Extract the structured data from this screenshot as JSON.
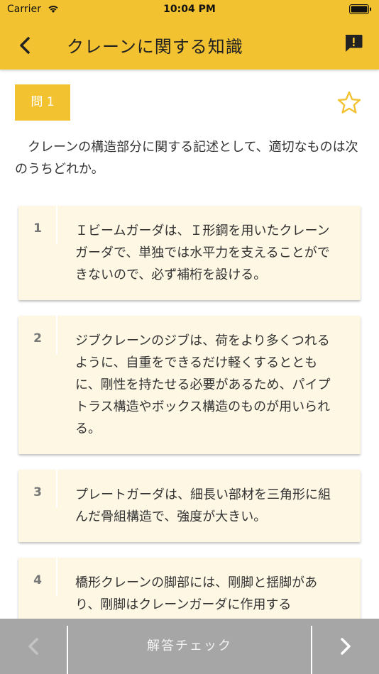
{
  "status_bar": {
    "carrier": "Carrier",
    "time": "10:04 PM"
  },
  "nav": {
    "title": "クレーンに関する知識"
  },
  "question": {
    "badge": "問 1",
    "text": "クレーンの構造部分に関する記述として、適切なものは次のうちどれか。"
  },
  "options": [
    {
      "num": "1",
      "text": "Ｉビームガーダは、Ｉ形鋼を用いたクレーンガーダで、単独では水平力を支えることができないので、必ず補桁を設ける。"
    },
    {
      "num": "2",
      "text": "ジブクレーンのジブは、荷をより多くつれるように、自重をできるだけ軽くするとともに、剛性を持たせる必要があるため、パイプトラス構造やボックス構造のものが用いられる。"
    },
    {
      "num": "3",
      "text": "プレートガーダは、細長い部材を三角形に組んだ骨組構造で、強度が大きい。"
    },
    {
      "num": "4",
      "text": "橋形クレーンの脚部には、剛脚と揺脚があり、剛脚はクレーンガーダに作用する"
    }
  ],
  "toolbar": {
    "check_label": "解答チェック"
  },
  "colors": {
    "accent": "#f2c230",
    "card_bg": "#fdf7e4",
    "toolbar_bg": "#a6a6a6"
  },
  "icons": {
    "back": "chevron-left-icon",
    "report": "exclamation-bubble-icon",
    "favorite": "star-outline-icon",
    "prev": "chevron-left-icon",
    "next": "chevron-right-icon"
  }
}
